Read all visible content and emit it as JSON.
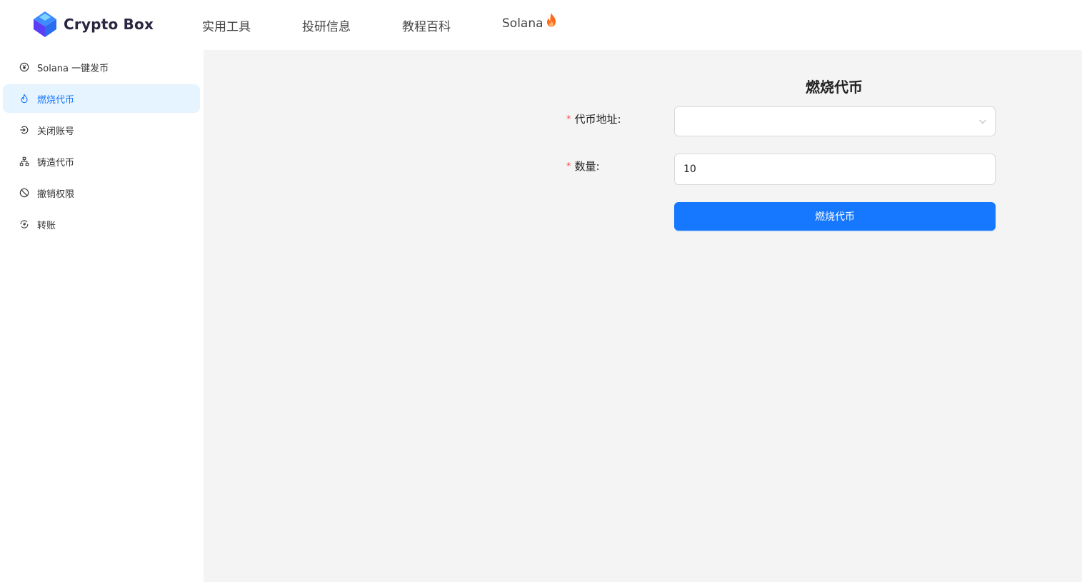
{
  "header": {
    "logo_text": "Crypto Box",
    "nav": [
      {
        "label": "实用工具"
      },
      {
        "label": "投研信息"
      },
      {
        "label": "教程百科"
      },
      {
        "label": "Solana",
        "icon": "flame-icon"
      }
    ]
  },
  "sidebar": {
    "items": [
      {
        "label": "Solana 一键发币",
        "icon": "yuan-circle-icon",
        "active": false
      },
      {
        "label": "燃烧代币",
        "icon": "fire-icon",
        "active": true
      },
      {
        "label": "关闭账号",
        "icon": "logout-circle-icon",
        "active": false
      },
      {
        "label": "铸造代币",
        "icon": "hierarchy-icon",
        "active": false
      },
      {
        "label": "撤销权限",
        "icon": "stop-icon",
        "active": false
      },
      {
        "label": "转账",
        "icon": "transfer-circle-icon",
        "active": false
      }
    ]
  },
  "form": {
    "title": "燃烧代币",
    "token_address": {
      "label": "代币地址:",
      "required_mark": "*",
      "value": ""
    },
    "amount": {
      "label": "数量:",
      "required_mark": "*",
      "value": "10"
    },
    "submit_label": "燃烧代币"
  },
  "colors": {
    "primary": "#1677ff",
    "active_bg": "#e6f4ff",
    "required": "#ff4d4f",
    "flame": "#ff6a1a"
  }
}
